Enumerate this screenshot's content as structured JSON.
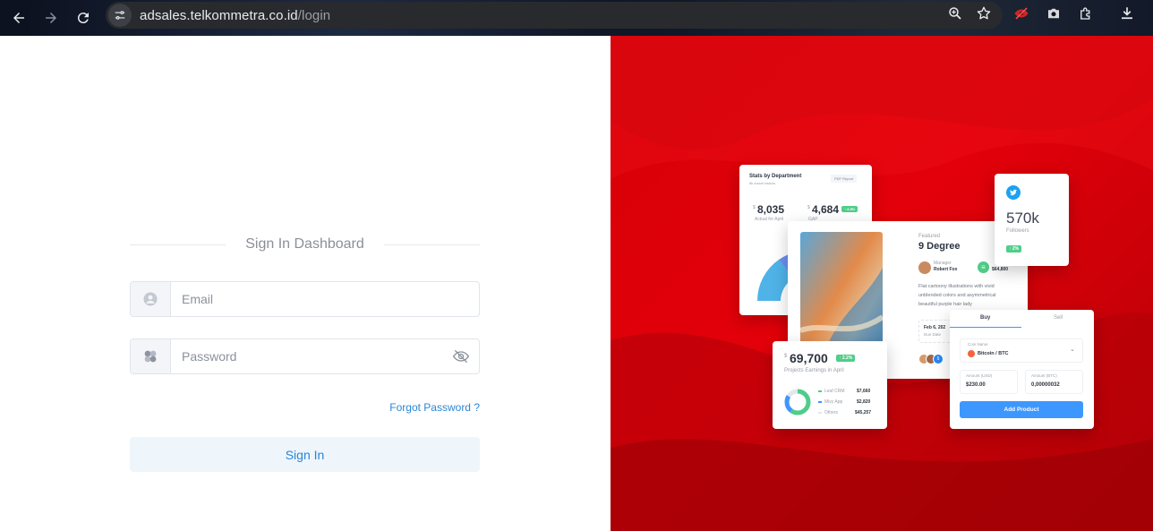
{
  "browser": {
    "url_host": "adsales.telkommetra.co.id",
    "url_path": "/login"
  },
  "login": {
    "title": "Sign In Dashboard",
    "email_placeholder": "Email",
    "password_placeholder": "Password",
    "forgot_label": "Forgot Password ?",
    "signin_label": "Sign In"
  },
  "hero": {
    "stats_card": {
      "title": "Stats by Department",
      "subtitle": "8k social visitors",
      "button": "PDF Report",
      "value1": "8,035",
      "value1_currency": "$",
      "value1_label": "Actual for April",
      "value2": "4,684",
      "value2_currency": "$",
      "value2_label": "GAP",
      "value2_badge": "↑ 4.5%"
    },
    "featured_card": {
      "kicker": "Featured",
      "title": "9 Degree",
      "manager_label": "Manager",
      "manager_name": "Robert Fox",
      "budget_value": "$64,800",
      "description_1": "Flat cartoony illustrations with vivid",
      "description_2": "unblended colors and asymmetrical",
      "description_3": "beautiful purple hair lady",
      "date": "Feb 6, 202",
      "date_label": "Due Date",
      "avatar_more": "5"
    },
    "twitter_card": {
      "value": "570k",
      "label": "Followers",
      "badge": "↑ 2%"
    },
    "earnings_card": {
      "currency": "$",
      "value": "69,700",
      "badge": "↑ 2.2%",
      "label": "Projects Earnings in April",
      "rows": [
        {
          "name": "Leaf CRM",
          "value": "$7,660"
        },
        {
          "name": "Mivy App",
          "value": "$2,820"
        },
        {
          "name": "Others",
          "value": "$45,257"
        }
      ]
    },
    "buy_card": {
      "tab_buy": "Buy",
      "tab_sell": "Sell",
      "coin_label": "Coin Name",
      "coin_value": "Bitcoin / BTC",
      "amount_usd_label": "Amount (USD)",
      "amount_usd": "$230.00",
      "amount_btc_label": "Amount (BTC)",
      "amount_btc": "0,00000032",
      "button": "Add Product"
    }
  },
  "colors": {
    "brand_red": "#e3000a",
    "link_blue": "#2b86d6",
    "primary_blue": "#3e97ff",
    "success_green": "#50cd89"
  }
}
